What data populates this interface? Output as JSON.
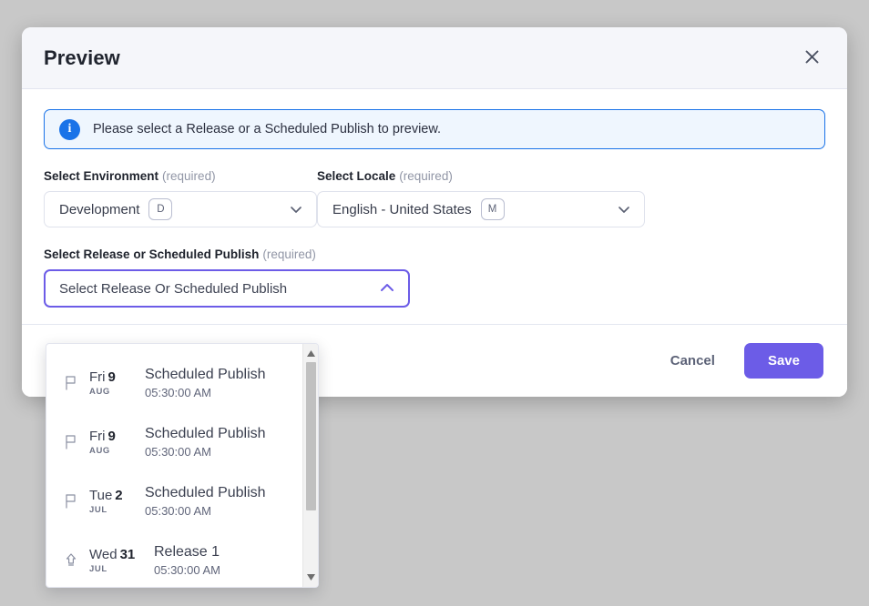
{
  "modal": {
    "title": "Preview",
    "close_icon": "close-icon"
  },
  "banner": {
    "icon": "info-circle-icon",
    "message": "Please select a Release or a Scheduled Publish to preview."
  },
  "fields": {
    "environment": {
      "label": "Select Environment",
      "required_text": "(required)",
      "value": "Development",
      "badge": "D",
      "chevron": "chevron-down-icon"
    },
    "locale": {
      "label": "Select Locale",
      "required_text": "(required)",
      "value": "English - United States",
      "badge": "M",
      "chevron": "chevron-down-icon"
    },
    "release": {
      "label": "Select Release or Scheduled Publish",
      "required_text": "(required)",
      "placeholder": "Select Release Or Scheduled Publish",
      "value": "Select Release Or Scheduled Publish",
      "chevron": "chevron-up-icon",
      "expanded": true
    }
  },
  "dropdown": {
    "options": [
      {
        "icon": "flag-icon",
        "weekday": "Fri",
        "day": "9",
        "month": "AUG",
        "title": "Scheduled Publish",
        "time": "05:30:00 AM"
      },
      {
        "icon": "flag-icon",
        "weekday": "Fri",
        "day": "9",
        "month": "AUG",
        "title": "Scheduled Publish",
        "time": "05:30:00 AM"
      },
      {
        "icon": "flag-icon",
        "weekday": "Tue",
        "day": "2",
        "month": "JUL",
        "title": "Scheduled Publish",
        "time": "05:30:00 AM"
      },
      {
        "icon": "rocket-icon",
        "weekday": "Wed",
        "day": "31",
        "month": "JUL",
        "title": "Release 1",
        "time": "05:30:00 AM"
      }
    ],
    "scrollbar": {
      "up_arrow_icon": "scroll-up-arrow-icon",
      "down_arrow_icon": "scroll-down-arrow-icon"
    }
  },
  "footer": {
    "cancel_label": "Cancel",
    "save_label": "Save"
  },
  "colors": {
    "accent_purple": "#6c5ce7",
    "info_blue": "#1a73e8",
    "info_bg": "#eff6fe",
    "header_bg": "#f5f6fa",
    "backdrop": "#c8c8c8"
  }
}
